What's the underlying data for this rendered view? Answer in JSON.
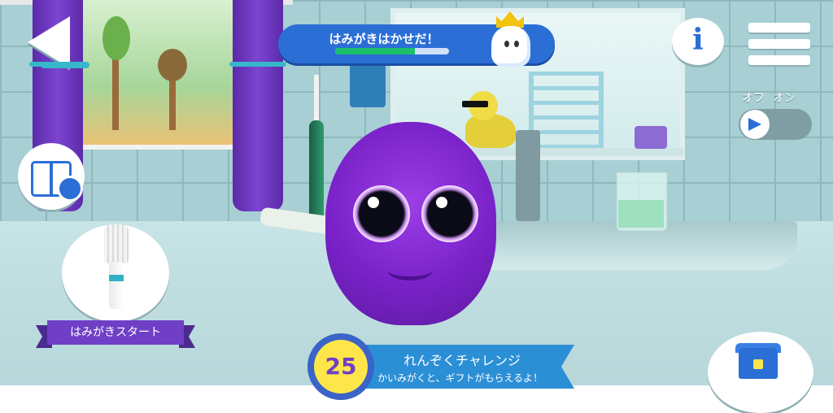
{
  "header": {
    "title": "はみがきはかせだ！",
    "progress_percent": 70
  },
  "toggle": {
    "off_label": "オフ",
    "on_label": "オン",
    "state": "off"
  },
  "start_button": {
    "label": "はみがきスタート"
  },
  "streak": {
    "count": "25",
    "title": "れんぞくチャレンジ",
    "subtitle": "かいみがくと、ギフトがもらえるよ！",
    "days_marker": "3"
  },
  "colors": {
    "accent": "#2b6fd6",
    "monster": "#7a22c9",
    "progress_fill": "#1cbf6a",
    "ribbon": "#6f3fc7",
    "badge_yellow": "#fde54a"
  },
  "icons": {
    "back": "back-arrow-icon",
    "info": "info-icon",
    "menu": "hamburger-menu-icon",
    "sound": "megaphone-icon",
    "calendar": "calendar-tooth-icon",
    "brush": "toothbrush-icon",
    "gift": "treasure-chest-icon",
    "mascot": "crowned-tooth-icon"
  }
}
